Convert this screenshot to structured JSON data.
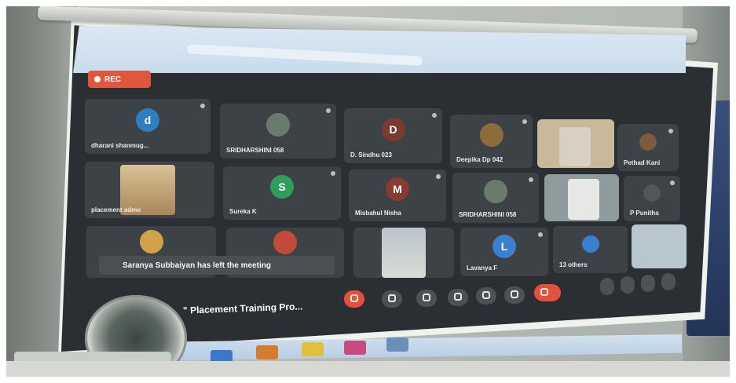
{
  "meeting": {
    "rec_label": "REC",
    "left_message": "Saranya Subbaiyan has left the meeting",
    "meeting_title": "\" Placement Training Pro..."
  },
  "participants": [
    {
      "name": "dharani shanmug...",
      "initial": "d",
      "color": "#2f7fbf"
    },
    {
      "name": "SRIDHARSHINI 058",
      "initial": "",
      "color": "#6a7b6d"
    },
    {
      "name": "D. Sindhu 023",
      "initial": "D",
      "color": "#7a3b2e"
    },
    {
      "name": "Deepika Dp 042",
      "initial": "",
      "color": "#8c6d3a"
    },
    {
      "name": "Pethad Kani",
      "initial": "",
      "color": "#7d5b3d"
    },
    {
      "name": "placement admo",
      "initial": "",
      "color": "#a07a45"
    },
    {
      "name": "Sureka K",
      "initial": "S",
      "color": "#2f9e5a"
    },
    {
      "name": "Misbahul Nisha",
      "initial": "M",
      "color": "#8a3b2f"
    },
    {
      "name": "SRIDHARSHINI 058",
      "initial": "",
      "color": "#6a7b6d"
    },
    {
      "name": "P Punitha",
      "initial": "",
      "color": "#555"
    },
    {
      "name": "Lavanya F",
      "initial": "L",
      "color": "#3b7fd0"
    },
    {
      "name": "13 others",
      "initial": "",
      "color": "#3b7fd0"
    }
  ],
  "colors": {
    "record": "#e0573d",
    "end_call": "#e3513c",
    "tile": "#3d4246"
  },
  "icons": [
    "mic-icon",
    "camera-icon",
    "captions-icon",
    "raise-hand-icon",
    "present-icon",
    "more-icon",
    "end-call-icon",
    "info-icon",
    "people-icon",
    "chat-icon",
    "activities-icon"
  ]
}
